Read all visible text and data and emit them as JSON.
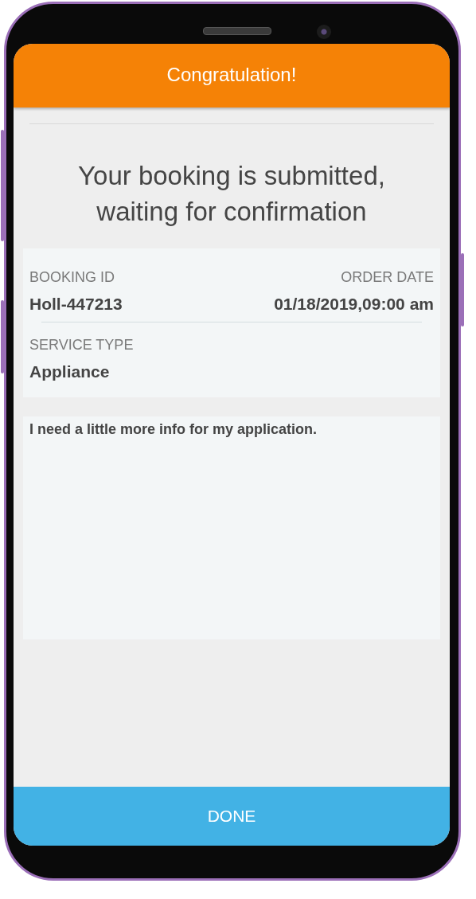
{
  "header": {
    "title": "Congratulation!"
  },
  "message": "Your booking is submitted, waiting for confirmation",
  "details": {
    "rows": [
      [
        {
          "label": "BOOKING ID",
          "value": "Holl-447213"
        },
        {
          "label": "ORDER DATE",
          "value": "01/18/2019,09:00 am"
        }
      ],
      [
        {
          "label": "SERVICE TYPE",
          "value": "Appliance"
        }
      ]
    ]
  },
  "note": {
    "value": "I need a little more info for my application."
  },
  "done_button": {
    "label": "DONE"
  }
}
